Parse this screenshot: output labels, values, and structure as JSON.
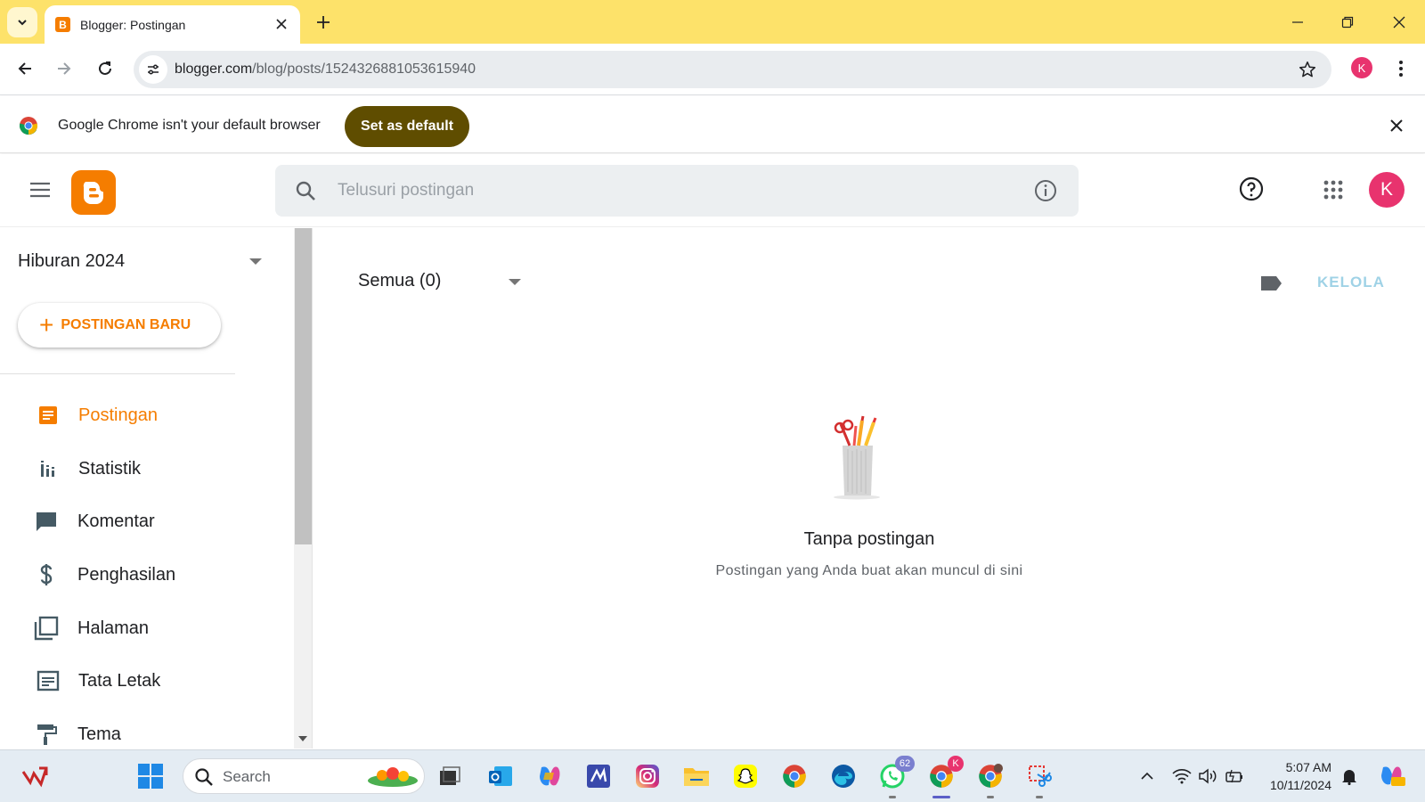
{
  "browser": {
    "tab_title": "Blogger: Postingan",
    "url_host": "blogger.com",
    "url_path": "/blog/posts/1524326881053615940",
    "profile_initial": "K",
    "accent_color": "#fde26a"
  },
  "infobar": {
    "message": "Google Chrome isn't your default browser",
    "button_label": "Set as default"
  },
  "app": {
    "brand_color": "#f57d00",
    "search_placeholder": "Telusuri postingan",
    "avatar_initial": "K"
  },
  "sidebar": {
    "blog_name": "Hiburan 2024",
    "new_post_label": "POSTINGAN BARU",
    "items": [
      {
        "label": "Postingan",
        "icon": "posts-icon",
        "active": true
      },
      {
        "label": "Statistik",
        "icon": "stats-icon"
      },
      {
        "label": "Komentar",
        "icon": "comment-icon"
      },
      {
        "label": "Penghasilan",
        "icon": "dollar-icon"
      },
      {
        "label": "Halaman",
        "icon": "pages-icon"
      },
      {
        "label": "Tata Letak",
        "icon": "layout-icon"
      },
      {
        "label": "Tema",
        "icon": "paint-roller-icon"
      }
    ]
  },
  "main": {
    "filter_label": "Semua (0)",
    "manage_label": "KELOLA",
    "empty_title": "Tanpa postingan",
    "empty_subtitle": "Postingan yang Anda buat akan muncul di sini"
  },
  "taskbar": {
    "search_label": "Search",
    "whatsapp_badge": "62",
    "chrome_badge": "K",
    "time": "5:07 AM",
    "date": "10/11/2024"
  }
}
